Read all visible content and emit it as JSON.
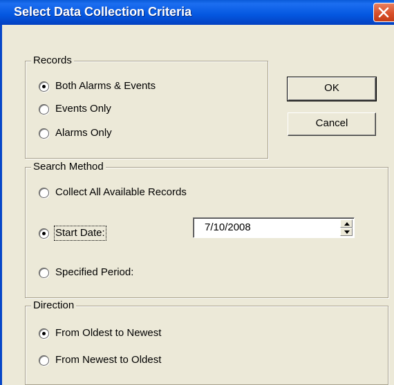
{
  "window": {
    "title": "Select Data Collection Criteria",
    "close_icon": "close-x-icon",
    "titlebar_color": "#0457e0",
    "close_color": "#d9502a",
    "face_color": "#ece9d8"
  },
  "records": {
    "legend": "Records",
    "options": [
      {
        "label": "Both Alarms & Events",
        "selected": true
      },
      {
        "label": "Events Only",
        "selected": false
      },
      {
        "label": "Alarms Only",
        "selected": false
      }
    ]
  },
  "buttons": {
    "ok_label": "OK",
    "cancel_label": "Cancel"
  },
  "search_method": {
    "legend": "Search Method",
    "options": [
      {
        "label": "Collect All Available Records",
        "selected": false
      },
      {
        "label": "Start Date:",
        "selected": true
      },
      {
        "label": "Specified Period:",
        "selected": false
      }
    ],
    "start_date_value": "7/10/2008",
    "spin_up_icon": "spin-up-arrow-icon",
    "spin_down_icon": "spin-down-arrow-icon"
  },
  "direction": {
    "legend": "Direction",
    "options": [
      {
        "label": "From Oldest to Newest",
        "selected": true
      },
      {
        "label": "From Newest to Oldest",
        "selected": false
      }
    ]
  }
}
